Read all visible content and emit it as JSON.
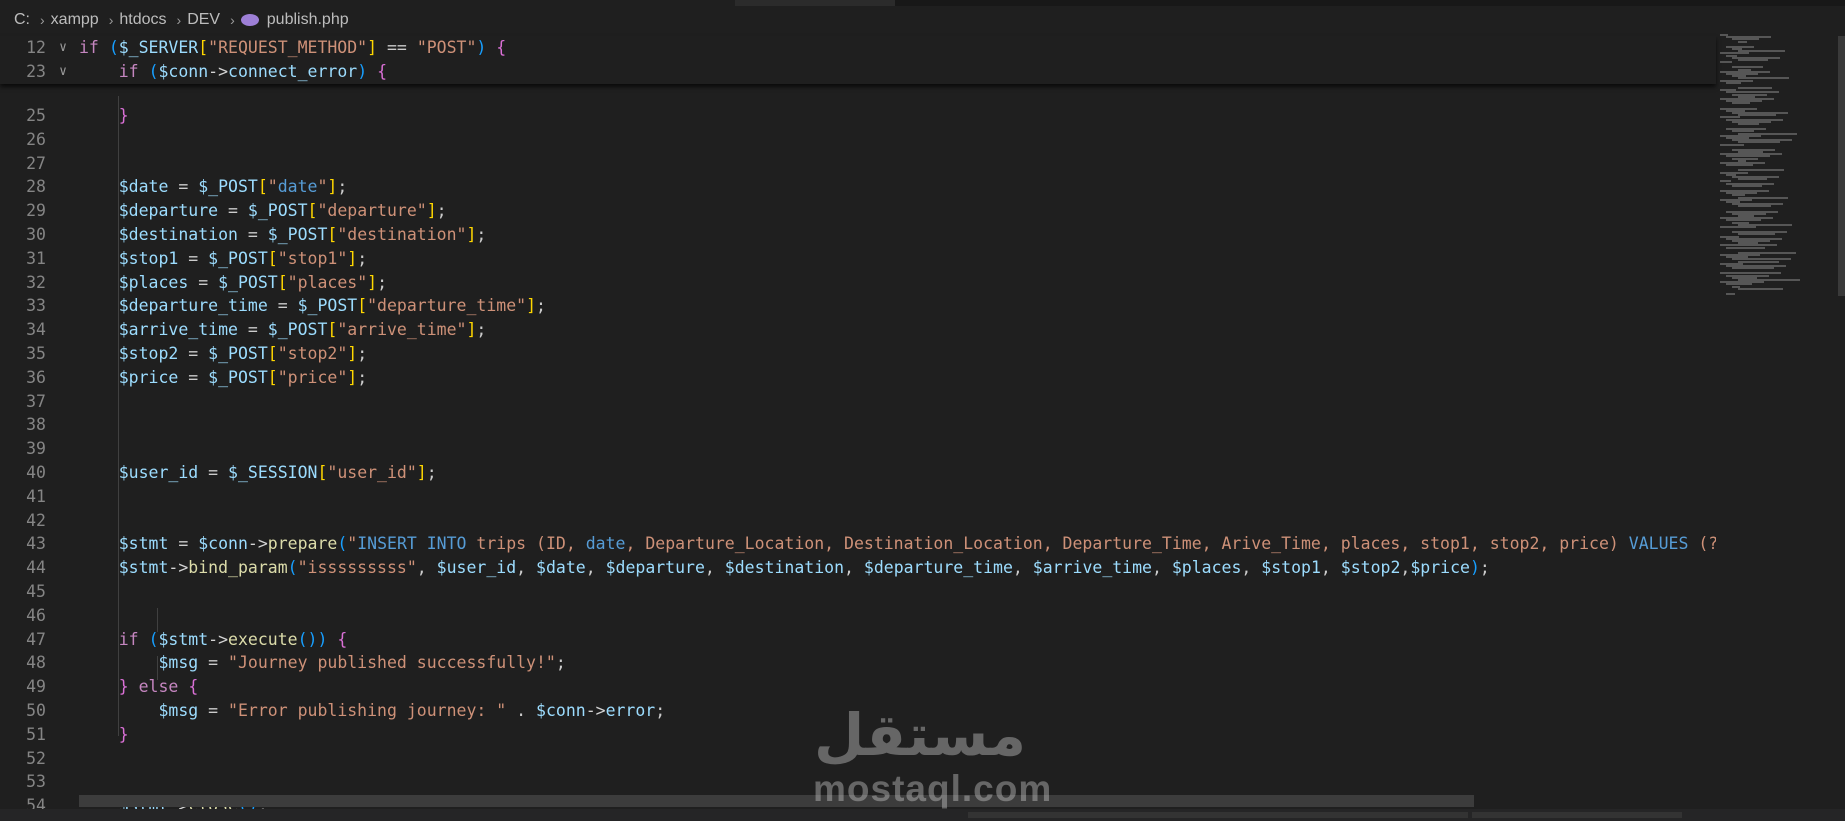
{
  "breadcrumb": {
    "drive": "C:",
    "folders": [
      "xampp",
      "htdocs",
      "DEV"
    ],
    "file": "publish.php",
    "file_icon": "php-icon"
  },
  "sticky_lines": [
    {
      "n": "12",
      "code": "if ($_SERVER[\"REQUEST_METHOD\"] == \"POST\") {"
    },
    {
      "n": "23",
      "code": "    if ($conn->connect_error) {"
    }
  ],
  "editor_lines": [
    {
      "n": "25",
      "code": "    }"
    },
    {
      "n": "26",
      "code": ""
    },
    {
      "n": "27",
      "code": ""
    },
    {
      "n": "28",
      "code": "    $date = $_POST[\"date\"];"
    },
    {
      "n": "29",
      "code": "    $departure = $_POST[\"departure\"];"
    },
    {
      "n": "30",
      "code": "    $destination = $_POST[\"destination\"];"
    },
    {
      "n": "31",
      "code": "    $stop1 = $_POST[\"stop1\"];"
    },
    {
      "n": "32",
      "code": "    $places = $_POST[\"places\"];"
    },
    {
      "n": "33",
      "code": "    $departure_time = $_POST[\"departure_time\"];"
    },
    {
      "n": "34",
      "code": "    $arrive_time = $_POST[\"arrive_time\"];"
    },
    {
      "n": "35",
      "code": "    $stop2 = $_POST[\"stop2\"];"
    },
    {
      "n": "36",
      "code": "    $price = $_POST[\"price\"];"
    },
    {
      "n": "37",
      "code": ""
    },
    {
      "n": "38",
      "code": ""
    },
    {
      "n": "39",
      "code": ""
    },
    {
      "n": "40",
      "code": "    $user_id = $_SESSION[\"user_id\"];"
    },
    {
      "n": "41",
      "code": ""
    },
    {
      "n": "42",
      "code": ""
    },
    {
      "n": "43",
      "code": "    $stmt = $conn->prepare(\"INSERT INTO trips (ID, date, Departure_Location, Destination_Location, Departure_Time, Arive_Time, places, stop1, stop2, price) VALUES (?, ?,"
    },
    {
      "n": "44",
      "code": "    $stmt->bind_param(\"isssssssss\", $user_id, $date, $departure, $destination, $departure_time, $arrive_time, $places, $stop1, $stop2,$price);"
    },
    {
      "n": "45",
      "code": ""
    },
    {
      "n": "46",
      "code": ""
    },
    {
      "n": "47",
      "code": "    if ($stmt->execute()) {"
    },
    {
      "n": "48",
      "code": "        $msg = \"Journey published successfully!\";"
    },
    {
      "n": "49",
      "code": "    } else {"
    },
    {
      "n": "50",
      "code": "        $msg = \"Error publishing journey: \" . $conn->error;"
    },
    {
      "n": "51",
      "code": "    }"
    },
    {
      "n": "52",
      "code": ""
    },
    {
      "n": "53",
      "code": ""
    },
    {
      "n": "54",
      "code": "    $stmt->close();"
    }
  ],
  "watermark": {
    "arabic": "مستقل",
    "latin": "mostaql.com"
  },
  "colors": {
    "background": "#1f1f1f",
    "keyword": "#c586c0",
    "variable": "#9cdcfe",
    "string": "#ce9178",
    "function": "#dcdcaa",
    "line_number": "#858585"
  }
}
